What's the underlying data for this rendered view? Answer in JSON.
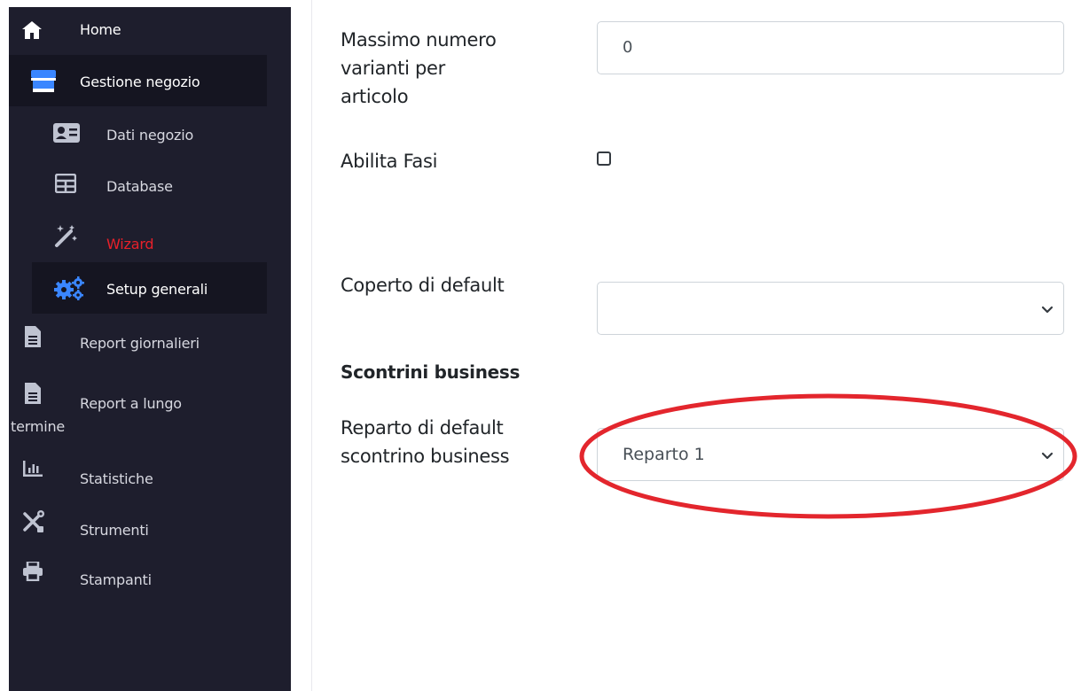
{
  "sidebar": {
    "items": [
      {
        "label": "Home",
        "icon": "home-icon"
      },
      {
        "label": "Gestione negozio",
        "icon": "store-icon"
      },
      {
        "label": "Dati negozio",
        "icon": "id-card-icon"
      },
      {
        "label": "Database",
        "icon": "table-icon"
      },
      {
        "label": "Wizard",
        "icon": "magic-wand-icon",
        "color": "#e8202a"
      },
      {
        "label": "Setup generali",
        "icon": "gears-icon",
        "color": "#3a86ff"
      },
      {
        "label": "Report giornalieri",
        "icon": "file-icon"
      },
      {
        "label": "Report a lungo",
        "label2": "termine",
        "icon": "file-icon"
      },
      {
        "label": "Statistiche",
        "icon": "chart-icon"
      },
      {
        "label": "Strumenti",
        "icon": "tools-icon"
      },
      {
        "label": "Stampanti",
        "icon": "printer-icon"
      }
    ],
    "background": "#1e1e2d",
    "active_background": "#151521"
  },
  "form": {
    "max_variants": {
      "label": "Massimo numero varianti per articolo",
      "label_line1": "Massimo numero",
      "label_line2": "varianti per",
      "label_line3": "articolo",
      "value": "0"
    },
    "abilita_fasi": {
      "label": "Abilita Fasi",
      "checked": false
    },
    "coperto_default": {
      "label": "Coperto di default",
      "value": ""
    },
    "section_title": "Scontrini business",
    "reparto_default": {
      "label_line1": "Reparto di default",
      "label_line2": "scontrino business",
      "value": "Reparto 1"
    }
  },
  "annotation": {
    "color": "#e3262d"
  }
}
